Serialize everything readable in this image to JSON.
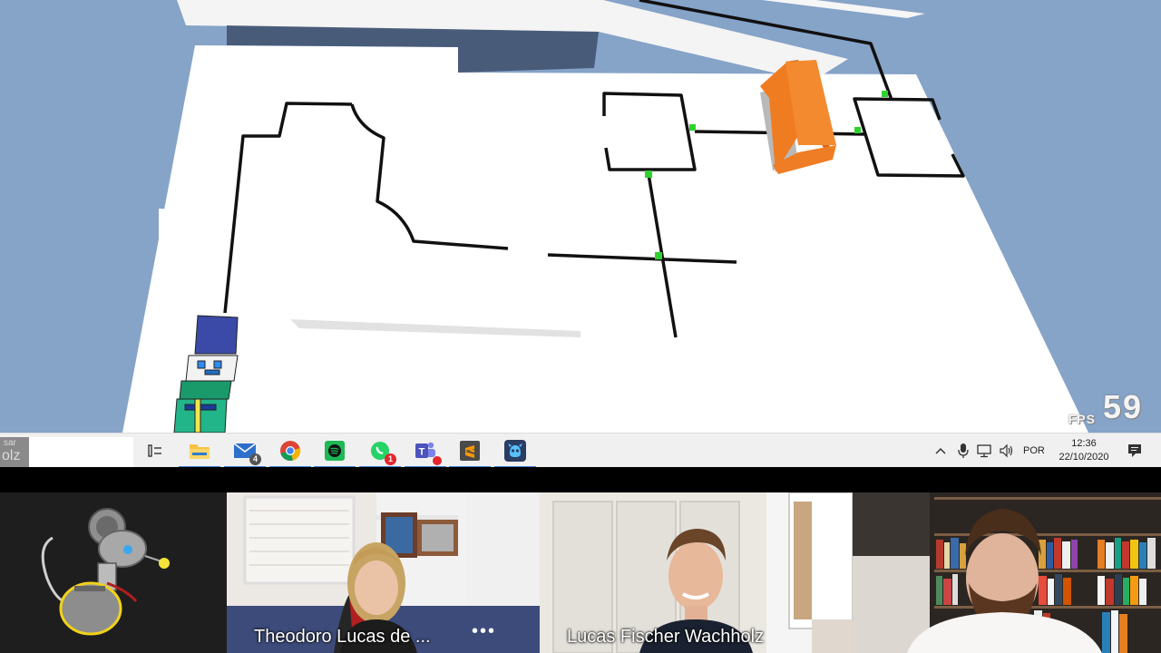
{
  "simulator": {
    "fps_label": "FPS",
    "fps_value": "59"
  },
  "taskbar": {
    "search_stub_top": "sar",
    "search_stub_bottom": "olz",
    "apps": [
      {
        "name": "task-view",
        "badge": ""
      },
      {
        "name": "file-explorer",
        "badge": ""
      },
      {
        "name": "mail",
        "badge": "4"
      },
      {
        "name": "chrome",
        "badge": ""
      },
      {
        "name": "spotify",
        "badge": ""
      },
      {
        "name": "whatsapp",
        "badge": "1"
      },
      {
        "name": "teams",
        "badge": ""
      },
      {
        "name": "sublime-text",
        "badge": ""
      },
      {
        "name": "simulator-app",
        "badge": ""
      }
    ],
    "tray": {
      "language": "POR",
      "time": "12:36",
      "date": "22/10/2020"
    }
  },
  "call": {
    "participants": [
      {
        "name": ""
      },
      {
        "name": "Theodoro Lucas de ..."
      },
      {
        "name": "Lucas Fischer Wachholz"
      },
      {
        "name": ""
      }
    ],
    "more_label": "•••"
  }
}
